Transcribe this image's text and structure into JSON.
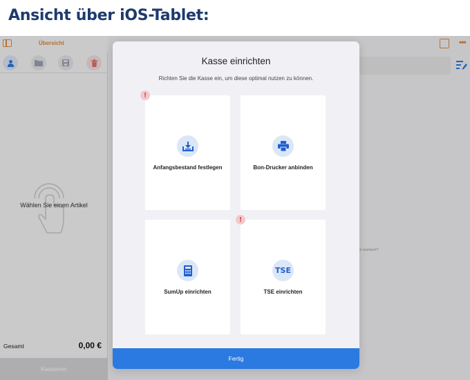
{
  "heading": "Ansicht über iOS-Tablet:",
  "left_panel": {
    "title": "Übersicht",
    "empty_text": "Wählen Sie einen Artikel",
    "total_label": "Gesamt",
    "total_value": "0,00 €",
    "checkout_label": "Kassieren"
  },
  "background": {
    "hint_text": "el markiert?"
  },
  "modal": {
    "title": "Kasse einrichten",
    "subtitle": "Richten Sie die Kasse ein, um diese optimal nutzen zu können.",
    "cards": [
      {
        "label": "Anfangsbestand festlegen",
        "icon": "download-tray-icon",
        "alert": true
      },
      {
        "label": "Bon-Drucker anbinden",
        "icon": "printer-icon",
        "alert": false
      },
      {
        "label": "SumUp einrichten",
        "icon": "card-terminal-icon",
        "alert": false
      },
      {
        "label": "TSE einrichten",
        "icon": "tse-icon",
        "icon_text": "TSE",
        "alert": true
      }
    ],
    "alert_symbol": "!",
    "done_label": "Fertig"
  },
  "colors": {
    "accent": "#e08a3c",
    "primary": "#2a7ae2",
    "heading": "#1e3a6e",
    "alert": "#d8232a"
  }
}
